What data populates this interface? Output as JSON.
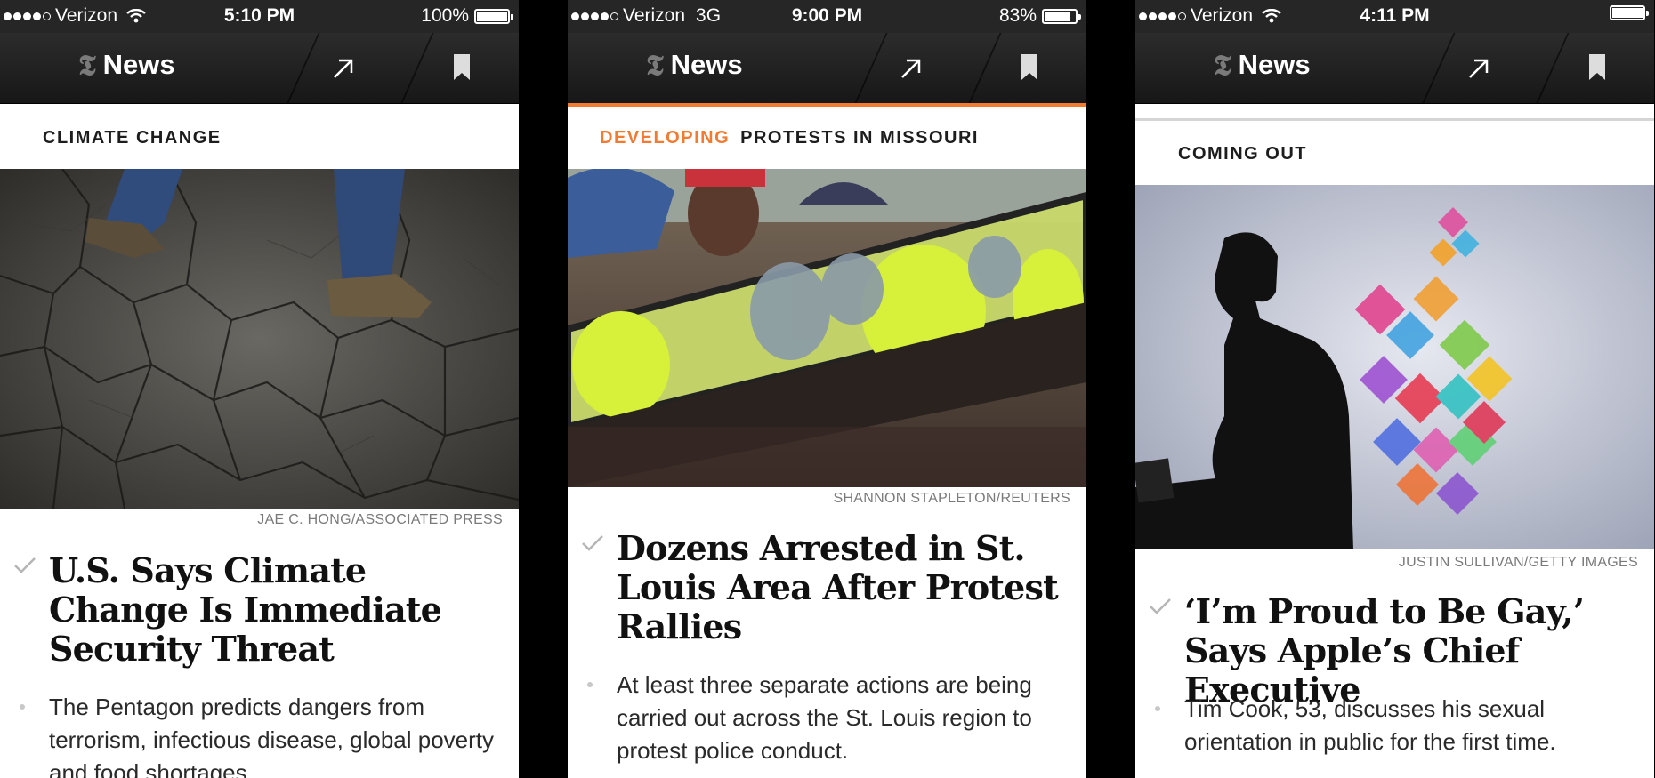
{
  "screens": [
    {
      "status": {
        "carrier": "Verizon",
        "network": "",
        "time": "5:10 PM",
        "battery": "100%",
        "battery_level": 1.0
      },
      "nav": {
        "title": "News"
      },
      "kicker": {
        "developing": "",
        "topic": "CLIMATE CHANGE"
      },
      "photo_credit": "JAE C. HONG/ASSOCIATED PRESS",
      "headline": "U.S. Says Climate Change Is Immediate Security Threat",
      "summary": "The Pentagon predicts dangers from terrorism, infectious disease, global poverty and food shortages."
    },
    {
      "status": {
        "carrier": "Verizon",
        "network": "3G",
        "time": "9:00 PM",
        "battery": "83%",
        "battery_level": 0.83
      },
      "nav": {
        "title": "News"
      },
      "kicker": {
        "developing": "DEVELOPING",
        "topic": "PROTESTS IN MISSOURI"
      },
      "photo_credit": "SHANNON STAPLETON/REUTERS",
      "headline": "Dozens Arrested in St. Louis Area After Protest Rallies",
      "summary": "At least three separate actions are being carried out across the St. Louis region to protest police conduct."
    },
    {
      "status": {
        "carrier": "Verizon",
        "network": "",
        "time": "4:11 PM",
        "battery": "",
        "battery_level": 1.0
      },
      "nav": {
        "title": "News"
      },
      "kicker": {
        "developing": "",
        "topic": "COMING OUT"
      },
      "photo_credit": "JUSTIN SULLIVAN/GETTY IMAGES",
      "headline": "‘I’m Proud to Be Gay,’ Says Apple’s Chief Executive",
      "summary": "Tim Cook, 53, discusses his sexual orientation in public for the first time."
    }
  ],
  "icons": {
    "logo": "nyt-t-logo-icon",
    "share": "share-arrow-icon",
    "bookmark": "bookmark-icon",
    "read": "checkmark-icon",
    "wifi": "wifi-icon",
    "battery": "battery-icon"
  },
  "colors": {
    "accent": "#f07b31",
    "nav_bar": "#222222",
    "credit": "#7a7a7a"
  }
}
